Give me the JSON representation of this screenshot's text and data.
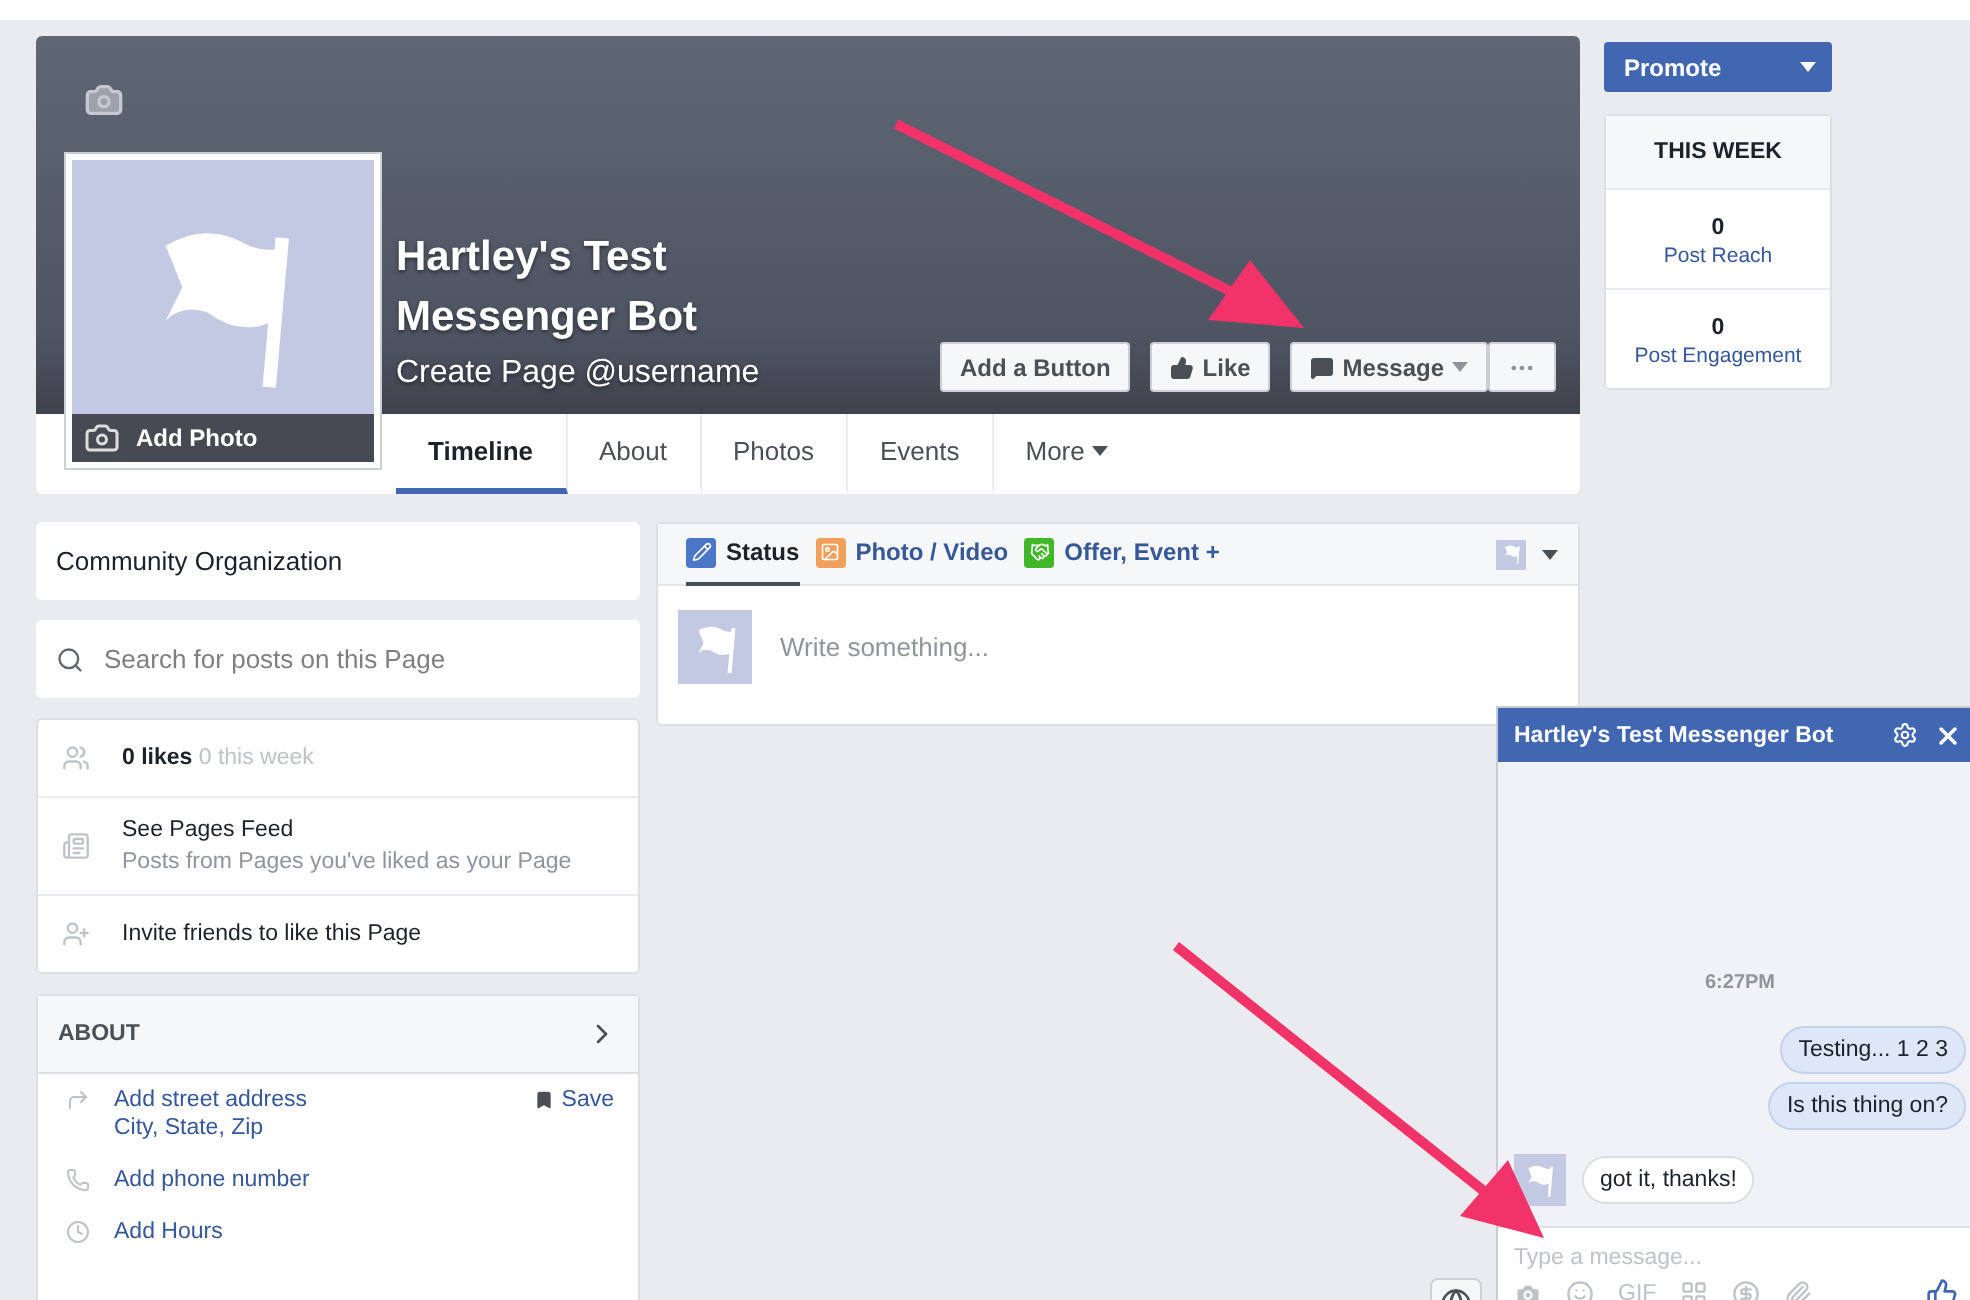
{
  "cover": {
    "title": "Hartley's Test Messenger Bot",
    "subtitle": "Create Page @username",
    "add_photo": "Add Photo",
    "buttons": [
      {
        "kind": "plain",
        "label": "Add a Button"
      },
      {
        "kind": "like",
        "label": "Like"
      },
      {
        "kind": "message",
        "label": "Message"
      },
      {
        "kind": "more"
      }
    ]
  },
  "tabs": [
    {
      "label": "Timeline",
      "selected": true,
      "kind": "tab"
    },
    {
      "label": "About",
      "selected": false,
      "kind": "tab"
    },
    {
      "label": "Photos",
      "selected": false,
      "kind": "tab"
    },
    {
      "label": "Events",
      "selected": false,
      "kind": "tab"
    },
    {
      "label": "More",
      "selected": false,
      "kind": "menu"
    }
  ],
  "promote": {
    "label": "Promote"
  },
  "this_week": {
    "title": "THIS WEEK",
    "stats": [
      {
        "value": "0",
        "label": "Post Reach"
      },
      {
        "value": "0",
        "label": "Post Engagement"
      }
    ]
  },
  "sidebar": {
    "category": "Community Organization",
    "search": {
      "placeholder": "Search for posts on this Page"
    },
    "items": [
      {
        "kind": "likes",
        "text": "0 likes",
        "sub": "0 this week"
      },
      {
        "kind": "feed",
        "text": "See Pages Feed",
        "sub": "Posts from Pages you've liked as your Page"
      },
      {
        "kind": "invite",
        "text": "Invite friends to like this Page"
      }
    ],
    "about": {
      "heading": "ABOUT",
      "items": [
        {
          "kind": "address",
          "text": "Add street address",
          "sub": "City, State, Zip",
          "action": "Save"
        },
        {
          "kind": "phone",
          "text": "Add phone number"
        },
        {
          "kind": "hours",
          "text": "Add Hours"
        }
      ]
    }
  },
  "composer": {
    "tabs": [
      {
        "kind": "status",
        "label": "Status",
        "selected": true
      },
      {
        "label": "Photo / Video",
        "selected": false
      },
      {
        "kind": "offer",
        "label": "Offer, Event +",
        "selected": false
      }
    ],
    "placeholder": "Write something..."
  },
  "chat": {
    "title": "Hartley's Test Messenger Bot",
    "time": "6:27PM",
    "messages": [
      {
        "text": "Testing... 1 2 3",
        "outgoing": true
      },
      {
        "text": "Is this thing on?",
        "outgoing": true
      },
      {
        "text": "got it, thanks!",
        "outgoing": false
      }
    ],
    "placeholder": "Type a message...",
    "gif": "GIF"
  }
}
